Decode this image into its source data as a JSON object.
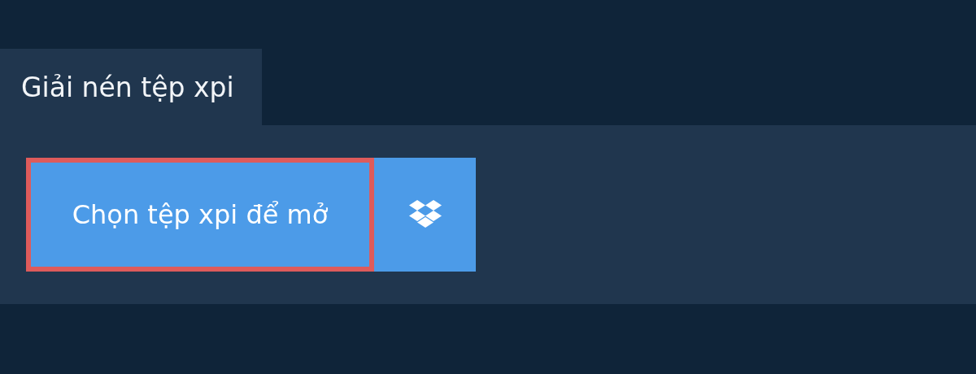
{
  "tab": {
    "label": "Giải nén tệp xpi",
    "selected": true
  },
  "buttons": [
    {
      "kind": "open",
      "label": "Chọn tệp xpi để mở",
      "focused": true
    },
    {
      "kind": "dropbox",
      "focused": false
    }
  ]
}
